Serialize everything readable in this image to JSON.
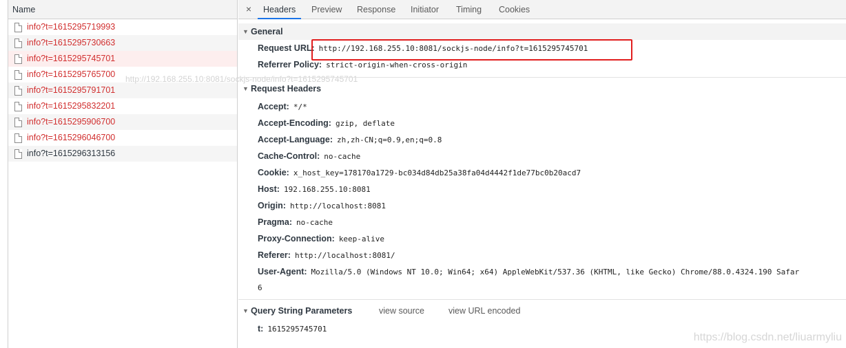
{
  "name_panel": {
    "header": "Name",
    "requests": [
      {
        "label": "info?t=1615295719993",
        "status": "error"
      },
      {
        "label": "info?t=1615295730663",
        "status": "error"
      },
      {
        "label": "info?t=1615295745701",
        "status": "error"
      },
      {
        "label": "info?t=1615295765700",
        "status": "error"
      },
      {
        "label": "info?t=1615295791701",
        "status": "error"
      },
      {
        "label": "info?t=1615295832201",
        "status": "error"
      },
      {
        "label": "info?t=1615295906700",
        "status": "error"
      },
      {
        "label": "info?t=1615296046700",
        "status": "error"
      },
      {
        "label": "info?t=1615296313156",
        "status": "ok"
      }
    ],
    "tooltip_ghost": "http://192.168.255.10:8081/sockjs-node/info?t=1615295745701"
  },
  "tabs": {
    "close": "×",
    "items": [
      "Headers",
      "Preview",
      "Response",
      "Initiator",
      "Timing",
      "Cookies"
    ],
    "active": "Headers"
  },
  "general": {
    "title": "General",
    "request_url_key": "Request URL:",
    "request_url_value": "http://192.168.255.10:8081/sockjs-node/info?t=1615295745701",
    "referrer_policy_key": "Referrer Policy:",
    "referrer_policy_value": "strict-origin-when-cross-origin"
  },
  "request_headers": {
    "title": "Request Headers",
    "rows": [
      {
        "key": "Accept:",
        "value": "*/*"
      },
      {
        "key": "Accept-Encoding:",
        "value": "gzip, deflate"
      },
      {
        "key": "Accept-Language:",
        "value": "zh,zh-CN;q=0.9,en;q=0.8"
      },
      {
        "key": "Cache-Control:",
        "value": "no-cache"
      },
      {
        "key": "Cookie:",
        "value": "x_host_key=178170a1729-bc034d84db25a38fa04d4442f1de77bc0b20acd7"
      },
      {
        "key": "Host:",
        "value": "192.168.255.10:8081"
      },
      {
        "key": "Origin:",
        "value": "http://localhost:8081"
      },
      {
        "key": "Pragma:",
        "value": "no-cache"
      },
      {
        "key": "Proxy-Connection:",
        "value": "keep-alive"
      },
      {
        "key": "Referer:",
        "value": "http://localhost:8081/"
      },
      {
        "key": "User-Agent:",
        "value": "Mozilla/5.0 (Windows NT 10.0; Win64; x64) AppleWebKit/537.36 (KHTML, like Gecko) Chrome/88.0.4324.190 Safar"
      }
    ],
    "user_agent_wrap": "6"
  },
  "query_string": {
    "title": "Query String Parameters",
    "view_source": "view source",
    "view_url_encoded": "view URL encoded",
    "param_key": "t:",
    "param_value": "1615295745701"
  },
  "colors": {
    "error_text": "#d12f2f",
    "active_tab_underline": "#1a73e8",
    "highlight_box": "#e11d1d"
  },
  "watermark": "https://blog.csdn.net/liuarmyliu"
}
